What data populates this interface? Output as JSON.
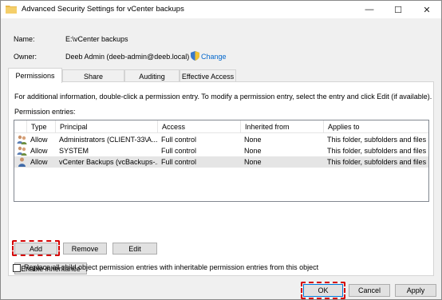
{
  "window": {
    "title": "Advanced Security Settings for vCenter backups",
    "minimize_glyph": "—",
    "maximize_glyph": "☐",
    "close_glyph": "✕"
  },
  "fields": {
    "name_label": "Name:",
    "name_value": "E:\\vCenter backups",
    "owner_label": "Owner:",
    "owner_value": "Deeb Admin (deeb-admin@deeb.local)",
    "change_link": "Change"
  },
  "tabs": [
    {
      "label": "Permissions",
      "active": true
    },
    {
      "label": "Share",
      "active": false
    },
    {
      "label": "Auditing",
      "active": false
    },
    {
      "label": "Effective Access",
      "active": false
    }
  ],
  "info_text": "For additional information, double-click a permission entry. To modify a permission entry, select the entry and click Edit (if available).",
  "entries_label": "Permission entries:",
  "columns": [
    "Type",
    "Principal",
    "Access",
    "Inherited from",
    "Applies to"
  ],
  "rows": [
    {
      "icon": "users-group-icon",
      "type": "Allow",
      "principal": "Administrators (CLIENT-33\\A...",
      "access": "Full control",
      "inherited": "None",
      "applies": "This folder, subfolders and files",
      "selected": false
    },
    {
      "icon": "users-group-icon",
      "type": "Allow",
      "principal": "SYSTEM",
      "access": "Full control",
      "inherited": "None",
      "applies": "This folder, subfolders and files",
      "selected": false
    },
    {
      "icon": "user-icon",
      "type": "Allow",
      "principal": "vCenter Backups (vcBackups-...",
      "access": "Full control",
      "inherited": "None",
      "applies": "This folder, subfolders and files",
      "selected": true
    }
  ],
  "buttons": {
    "add": "Add",
    "remove": "Remove",
    "edit": "Edit",
    "enable_inheritance": "Enable inheritance",
    "ok": "OK",
    "cancel": "Cancel",
    "apply": "Apply"
  },
  "replace_checkbox": {
    "label": "Replace all child object permission entries with inheritable permission entries from this object",
    "checked": false
  },
  "colors": {
    "highlight": "#d40000",
    "link": "#0066cc",
    "folder": "#e8b84a"
  }
}
